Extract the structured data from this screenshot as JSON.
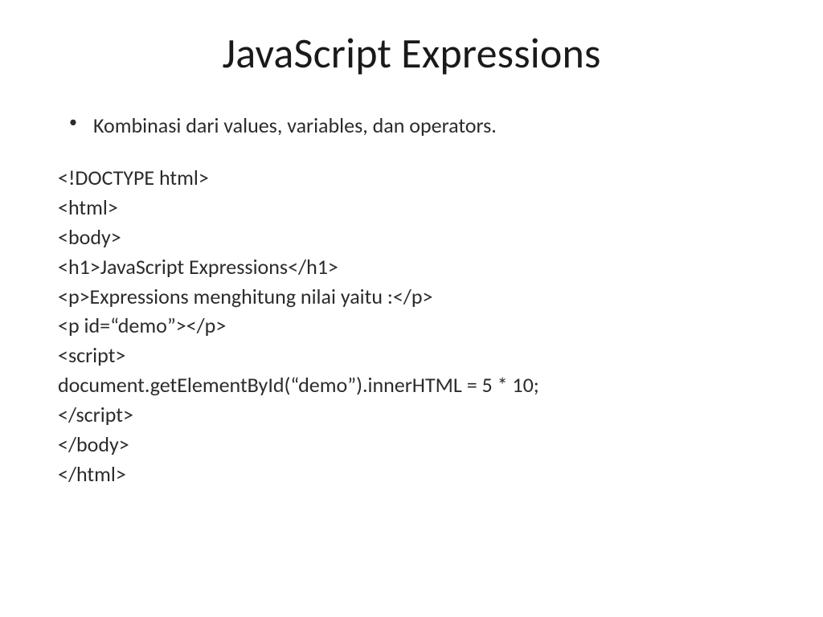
{
  "slide": {
    "title": "JavaScript Expressions",
    "bullet_1": "Kombinasi dari values, variables, dan operators.",
    "code": {
      "l1": "<!DOCTYPE html>",
      "l2": "<html>",
      "l3": "<body>",
      "l4": "<h1>JavaScript Expressions</h1>",
      "l5": "<p>Expressions menghitung nilai yaitu :</p>",
      "l6": "<p id=“demo”></p>",
      "l7": "<script>",
      "l8": "document.getElementById(“demo”).innerHTML = 5 * 10;",
      "l9": "</script>",
      "l10": "</body>",
      "l11": "</html>"
    }
  }
}
